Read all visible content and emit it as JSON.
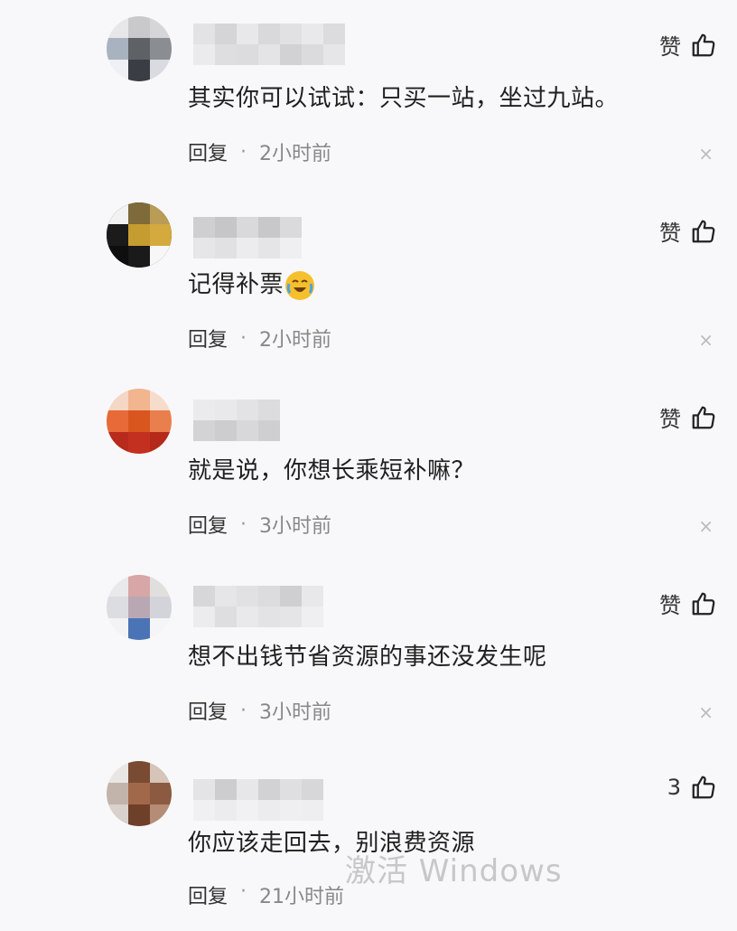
{
  "comments": [
    {
      "content": "其实你可以试试：只买一站，坐过九站。",
      "like_label": "赞",
      "reply_label": "回复",
      "separator": "·",
      "time": "2小时前",
      "close_glyph": "×"
    },
    {
      "content": "记得补票",
      "like_label": "赞",
      "reply_label": "回复",
      "separator": "·",
      "time": "2小时前",
      "close_glyph": "×"
    },
    {
      "content": "就是说，你想长乘短补嘛？",
      "like_label": "赞",
      "reply_label": "回复",
      "separator": "·",
      "time": "3小时前",
      "close_glyph": "×"
    },
    {
      "content": "想不出钱节省资源的事还没发生呢",
      "like_label": "赞",
      "reply_label": "回复",
      "separator": "·",
      "time": "3小时前",
      "close_glyph": "×"
    },
    {
      "content": "你应该走回去，别浪费资源",
      "like_label": "3",
      "reply_label": "回复",
      "separator": "·",
      "time": "21小时前",
      "close_glyph": "×"
    }
  ],
  "emoji_name": "crying-laughing-emoji",
  "watermark": "激活 Windows",
  "icons": {
    "like": "thumb-up-icon",
    "close": "close-icon"
  }
}
